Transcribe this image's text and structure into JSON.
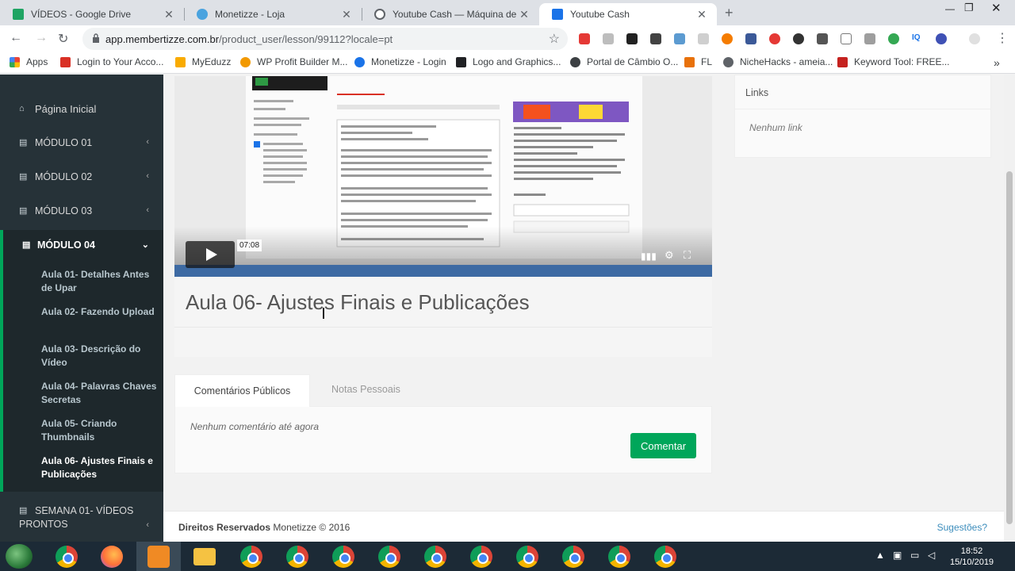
{
  "browser": {
    "tabs": [
      {
        "title": "VÍDEOS - Google Drive",
        "color": "#1fa463"
      },
      {
        "title": "Monetizze - Loja",
        "color": "#4aa3df"
      },
      {
        "title": "Youtube Cash — Máquina de Co",
        "color": "#5f6368"
      },
      {
        "title": "Youtube Cash",
        "color": "#1a73e8"
      }
    ],
    "url_host": "app.membertizze.com.br",
    "url_path": "/product_user/lesson/99112?locale=pt",
    "bookmarks": [
      {
        "label": "Apps",
        "color": "#4285f4"
      },
      {
        "label": "Login to Your Acco...",
        "color": "#d93025"
      },
      {
        "label": "MyEduzz",
        "color": "#f9ab00"
      },
      {
        "label": "WP Profit Builder M...",
        "color": "#f29900"
      },
      {
        "label": "Monetizze - Login",
        "color": "#1a73e8"
      },
      {
        "label": "Logo and Graphics...",
        "color": "#202124"
      },
      {
        "label": "Portal de Câmbio O...",
        "color": "#3c4043"
      },
      {
        "label": "FL",
        "color": "#e8710a"
      },
      {
        "label": "NicheHacks - ameia...",
        "color": "#5f6368"
      },
      {
        "label": "Keyword Tool: FREE...",
        "color": "#c5221f"
      }
    ]
  },
  "sidebar": {
    "home": "Página Inicial",
    "modules": [
      "MÓDULO 01",
      "MÓDULO 02",
      "MÓDULO 03",
      "MÓDULO 04"
    ],
    "lessons": [
      "Aula 01- Detalhes Antes de Upar",
      "Aula 02- Fazendo Upload",
      "Aula 03- Descrição do Vídeo",
      "Aula 04- Palavras Chaves Secretas",
      "Aula 05- Criando Thumbnails",
      "Aula 06- Ajustes Finais e Publicações"
    ],
    "week": "SEMANA 01- VÍDEOS PRONTOS"
  },
  "video": {
    "time": "07:08"
  },
  "lesson": {
    "title": "Aula 06- Ajustes Finais e Publicações"
  },
  "comments": {
    "tab_public": "Comentários Públicos",
    "tab_personal": "Notas Pessoais",
    "empty": "Nenhum comentário até agora",
    "button": "Comentar"
  },
  "links": {
    "title": "Links",
    "empty": "Nenhum link"
  },
  "footer": {
    "rights": "Direitos Reservados",
    "brand": "Monetizze © 2016",
    "suggestions": "Sugestões?"
  },
  "clock": {
    "time": "18:52",
    "date": "15/10/2019"
  },
  "colors": {
    "accent": "#00a65a",
    "sidebar": "#263238",
    "link": "#3c8dbc"
  }
}
